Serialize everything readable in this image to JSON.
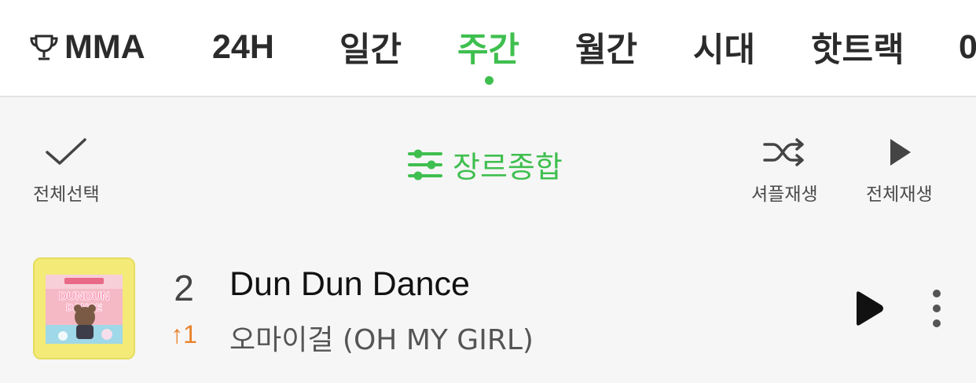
{
  "tabs": [
    {
      "label": "MMA",
      "icon": "trophy-icon",
      "active": false
    },
    {
      "label": "24H",
      "active": false
    },
    {
      "label": "일간",
      "active": false
    },
    {
      "label": "주간",
      "active": true
    },
    {
      "label": "월간",
      "active": false
    },
    {
      "label": "시대",
      "active": false
    },
    {
      "label": "핫트랙",
      "active": false
    },
    {
      "label": "0",
      "active": false
    }
  ],
  "toolbar": {
    "select_all_label": "전체선택",
    "select_all_icon": "checkmark-icon",
    "genre_label": "장르종합",
    "genre_icon": "sliders-icon",
    "shuffle_label": "셔플재생",
    "shuffle_icon": "shuffle-icon",
    "play_all_label": "전체재생",
    "play_all_icon": "play-icon"
  },
  "song": {
    "rank": "2",
    "rank_change": "↑1",
    "title": "Dun Dun Dance",
    "artist": "오마이걸 (OH MY GIRL)",
    "play_icon": "play-icon",
    "more_icon": "more-vertical-icon"
  },
  "colors": {
    "accent": "#3fbf4f",
    "rank_up": "#e8832a",
    "cover_background": "#f4ea78"
  }
}
